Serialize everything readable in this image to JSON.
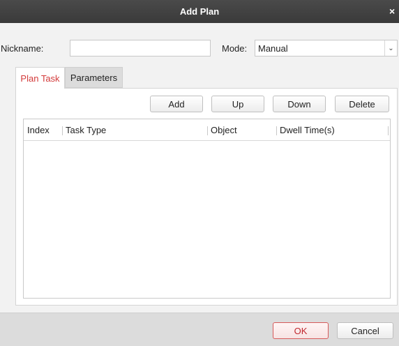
{
  "window": {
    "title": "Add Plan",
    "close_glyph": "×"
  },
  "form": {
    "nickname_label": "Nickname:",
    "nickname_value": "",
    "mode_label": "Mode:",
    "mode_value": "Manual",
    "mode_arrow_glyph": "⌄"
  },
  "tabs": [
    {
      "label": "Plan Task",
      "active": true
    },
    {
      "label": "Parameters",
      "active": false
    }
  ],
  "toolbar": {
    "add_label": "Add",
    "up_label": "Up",
    "down_label": "Down",
    "delete_label": "Delete"
  },
  "table": {
    "columns": [
      "Index",
      "Task Type",
      "Object",
      "Dwell Time(s)"
    ],
    "rows": []
  },
  "footer": {
    "ok_label": "OK",
    "cancel_label": "Cancel"
  },
  "colors": {
    "titlebar": "#3f3f3f",
    "active_tab_text": "#d33a3a",
    "ok_border": "#d65a5a"
  }
}
